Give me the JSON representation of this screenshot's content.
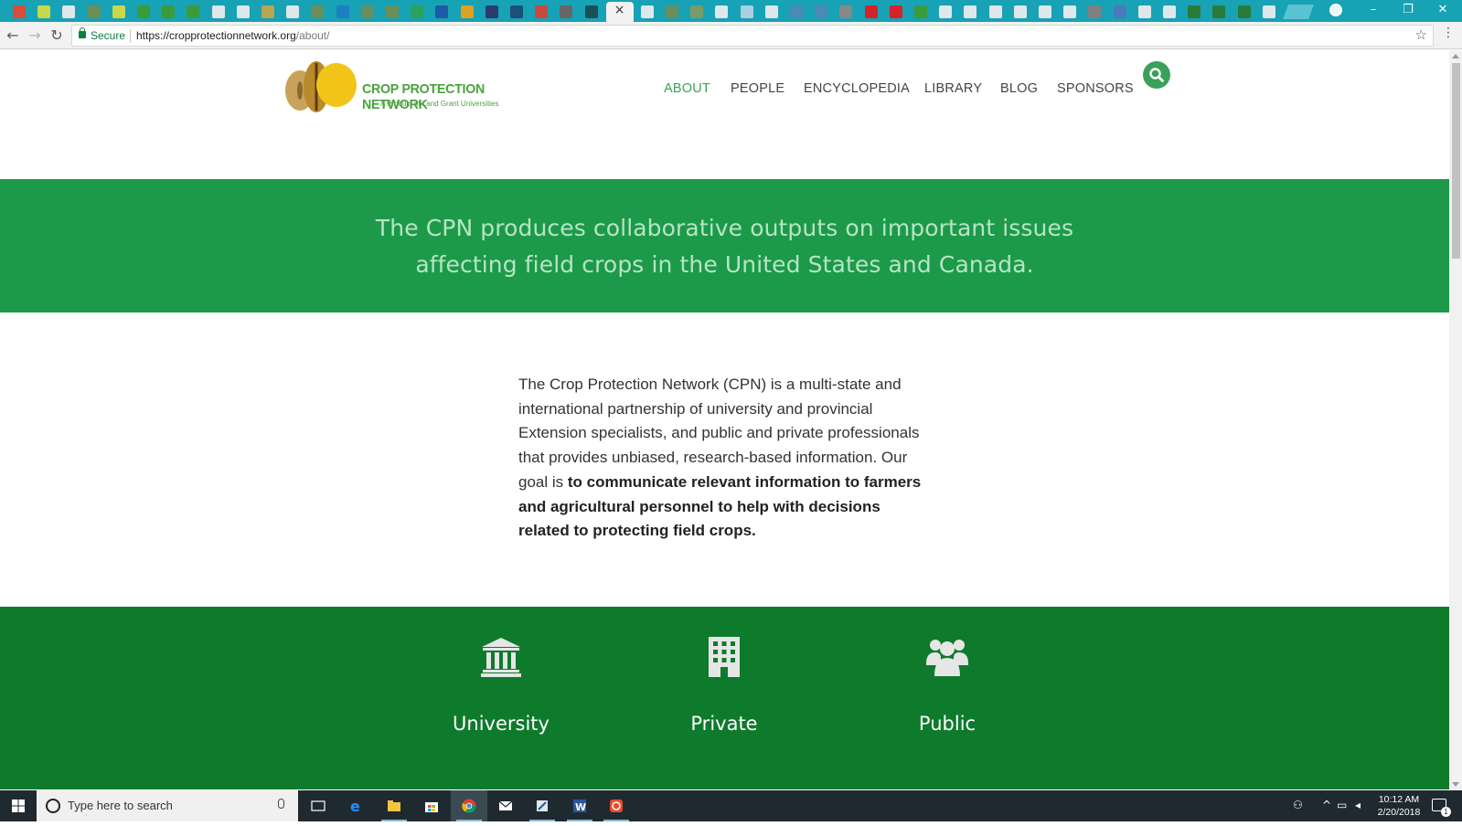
{
  "browser": {
    "tab_favicon_colors": [
      "#d94b3a",
      "#c7d94b",
      "#dfe7ea",
      "#6a8f5a",
      "#c7d94b",
      "#3a9b3a",
      "#3a9b3a",
      "#3a9b3a",
      "#dfe7ea",
      "#dfe7ea",
      "#b8a74f",
      "#dfe7ea",
      "#6a8f5a",
      "#1c7fbf",
      "#6a8f5a",
      "#6a8f5a",
      "#2aa25a",
      "#1c5aa8",
      "#e0a020",
      "#2b3b6b",
      "#1c4f7a",
      "#c94a3a",
      "#666666",
      "#1a4f5a"
    ],
    "tab_favicon_colors_right": [
      "#dfe7ea",
      "#6a8f5a",
      "#7a9a6a",
      "#dfe7ea",
      "#a8d0e0",
      "#dfe7ea",
      "#4a8ab8",
      "#4a8ab8",
      "#888888",
      "#d6222a",
      "#d6222a",
      "#3a9b3a",
      "#dfe7ea",
      "#dfe7ea",
      "#dfe7ea",
      "#dfe7ea",
      "#dfe7ea",
      "#dfe7ea",
      "#808080",
      "#4a7ab8",
      "#dfe7ea",
      "#dfe7ea",
      "#2a7a3a",
      "#2a7a3a",
      "#2a7a3a",
      "#dfe7ea"
    ],
    "active_tab_close": "×",
    "window_controls": {
      "minimize": "–",
      "restore": "❐",
      "close": "✕"
    },
    "secure_label": "Secure",
    "url_host": "https://cropprotectionnetwork.org",
    "url_path": "/about/"
  },
  "site": {
    "logo_title": "CROP PROTECTION NETWORK",
    "logo_subtitle": "A Product of Land Grant Universities",
    "nav": [
      {
        "label": "ABOUT",
        "active": true
      },
      {
        "label": "PEOPLE",
        "active": false
      },
      {
        "label": "ENCYCLOPEDIA",
        "active": false
      },
      {
        "label": "LIBRARY",
        "active": false
      },
      {
        "label": "BLOG",
        "active": false
      },
      {
        "label": "SPONSORS",
        "active": false
      }
    ],
    "hero_line1": "The CPN produces collaborative outputs on important issues",
    "hero_line2": "affecting field crops in the United States and Canada.",
    "intro_regular": "The Crop Protection Network (CPN) is a multi-state and international partnership of university and provincial Extension specialists, and public and private professionals that provides unbiased, research-based information. Our goal is ",
    "intro_bold": "to communicate relevant information to farmers and agricultural personnel to help with decisions related to protecting field crops.",
    "features": [
      {
        "label": "University",
        "icon": "university-icon"
      },
      {
        "label": "Private",
        "icon": "building-icon"
      },
      {
        "label": "Public",
        "icon": "users-icon"
      }
    ],
    "colors": {
      "hero_bg": "#1c9a4a",
      "features_bg": "#0e7a2c",
      "accent": "#3aa05a"
    }
  },
  "taskbar": {
    "search_placeholder": "Type here to search",
    "time": "10:12 AM",
    "date": "2/20/2018",
    "notification_count": "1"
  }
}
